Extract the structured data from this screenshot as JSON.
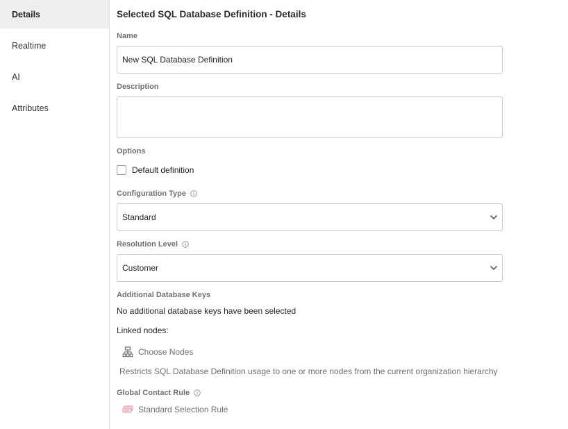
{
  "sidebar": {
    "items": [
      {
        "label": "Details",
        "active": true
      },
      {
        "label": "Realtime",
        "active": false
      },
      {
        "label": "AI",
        "active": false
      },
      {
        "label": "Attributes",
        "active": false
      }
    ]
  },
  "main": {
    "title": "Selected SQL Database Definition - Details",
    "name": {
      "label": "Name",
      "value": "New SQL Database Definition"
    },
    "description": {
      "label": "Description",
      "value": ""
    },
    "options": {
      "label": "Options",
      "default_definition_label": "Default definition",
      "default_definition_checked": false
    },
    "configuration_type": {
      "label": "Configuration Type",
      "value": "Standard"
    },
    "resolution_level": {
      "label": "Resolution Level",
      "value": "Customer"
    },
    "additional_keys": {
      "label": "Additional Database Keys",
      "empty_text": "No additional database keys have been selected"
    },
    "linked_nodes": {
      "label": "Linked nodes:",
      "choose_label": "Choose Nodes",
      "hint": "Restricts SQL Database Definition usage to one or more nodes from the current organization hierarchy"
    },
    "global_contact_rule": {
      "label": "Global Contact Rule",
      "value": "Standard Selection Rule"
    }
  },
  "icons": {
    "info": "info-circle-icon",
    "chevron": "chevron-down-icon",
    "nodes": "hierarchy-icon",
    "rule": "rule-stack-icon"
  },
  "colors": {
    "active_nav_bg": "#eeeeee",
    "rule_icon": "#e6909f",
    "border": "#c8c8c8"
  }
}
